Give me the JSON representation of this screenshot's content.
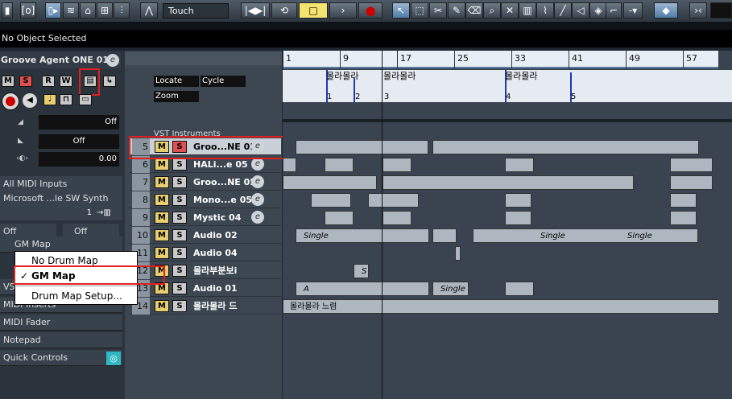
{
  "toolbar": {
    "automation_mode": "Touch"
  },
  "info_bar": {
    "status": "No Object Selected"
  },
  "inspector": {
    "track_title": "Groove Agent ONE 01",
    "buttons": {
      "mute": "M",
      "solo": "S",
      "read": "R",
      "write": "W"
    },
    "volume_label": "Off",
    "pan_label": "Off",
    "delay_value": "0.00",
    "midi_input": "All MIDI Inputs",
    "midi_output": "Microsoft ...le SW Synth",
    "channel": "1",
    "bank": "Off",
    "program": "Off",
    "drum_map": "GM Map",
    "sections": [
      "VST",
      "MIDI Inserts",
      "MIDI Fader",
      "Notepad",
      "Quick Controls"
    ]
  },
  "track_header": {
    "locate": "Locate",
    "cycle": "Cycle",
    "zoom": "Zoom",
    "folder_name": "VST Instruments"
  },
  "tracks": [
    {
      "num": "5",
      "name": "Groo...NE 01",
      "edit": "e"
    },
    {
      "num": "6",
      "name": "HALi...e 05",
      "edit": "e"
    },
    {
      "num": "7",
      "name": "Groo...NE 05",
      "edit": "e"
    },
    {
      "num": "8",
      "name": "Mono...e 05",
      "edit": "e"
    },
    {
      "num": "9",
      "name": "Mystic 04",
      "edit": "e"
    },
    {
      "num": "10",
      "name": "Audio 02",
      "edit": ""
    },
    {
      "num": "11",
      "name": "Audio 04",
      "edit": ""
    },
    {
      "num": "12",
      "name": "몰라부분보i",
      "edit": ""
    },
    {
      "num": "13",
      "name": "Audio 01",
      "edit": ""
    },
    {
      "num": "14",
      "name": "몰라몰라 드",
      "edit": ""
    }
  ],
  "ruler": {
    "bars": [
      "1",
      "9",
      "17",
      "25",
      "33",
      "41",
      "49",
      "57"
    ]
  },
  "markers": [
    {
      "label": "몰라몰라",
      "id": "1"
    },
    {
      "label": "",
      "id": "2"
    },
    {
      "label": "몰라몰라",
      "id": "3"
    },
    {
      "label": "몰라몰라",
      "id": "4"
    },
    {
      "label": "",
      "id": "5"
    }
  ],
  "part_labels": {
    "single": "Single",
    "s": "S",
    "a": "A",
    "last": "몰라몰라 느렴"
  },
  "popup_menu": {
    "items": [
      "No Drum Map",
      "GM Map",
      "Drum Map Setup..."
    ],
    "checked": "GM Map",
    "checkmark": "✓"
  }
}
